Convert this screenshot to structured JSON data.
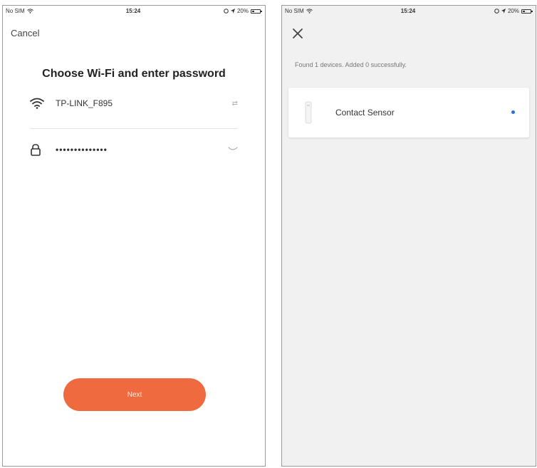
{
  "left_screen": {
    "status_bar": {
      "carrier": "No SIM",
      "time": "15:24",
      "battery": "20%"
    },
    "cancel_label": "Cancel",
    "title": "Choose Wi-Fi and enter password",
    "wifi": {
      "ssid": "TP-LINK_F895",
      "action": "⇄"
    },
    "password": {
      "value": "••••••••••••••",
      "toggle_icon": "eye-closed-icon"
    },
    "next_label": "Next"
  },
  "right_screen": {
    "status_bar": {
      "carrier": "No SIM",
      "time": "15:24",
      "battery": "20%"
    },
    "close_icon": "close-icon",
    "found_text": "Found 1 devices. Added 0 successfully.",
    "devices": [
      {
        "name": "Contact Sensor",
        "icon": "contact-sensor-icon",
        "status_color": "#2a6fdb"
      }
    ]
  },
  "colors": {
    "accent": "#f06a3f",
    "status_dot": "#2a6fdb",
    "right_background": "#f1f1f1"
  }
}
